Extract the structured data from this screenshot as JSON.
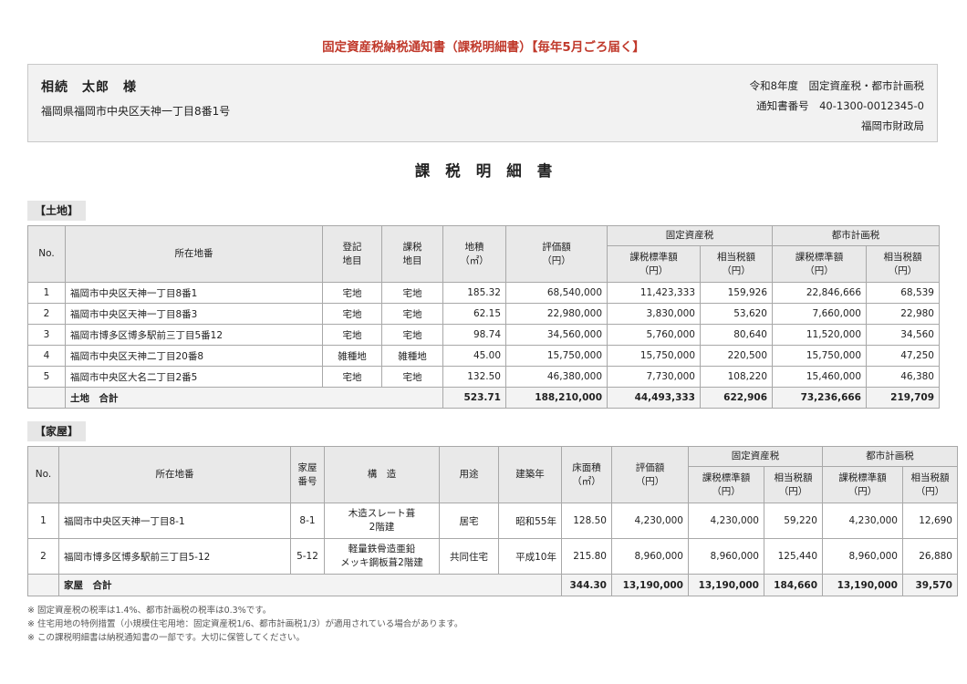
{
  "top_title": "固定資産税納税通知書（課税明細書）【毎年5月ごろ届く】",
  "header": {
    "name": "相続　太郎　様",
    "address": "福岡県福岡市中央区天神一丁目8番1号",
    "year_line": "令和8年度　固定資産税・都市計画税",
    "notice_line": "通知書番号　40-1300-0012345-0",
    "office": "福岡市財政局"
  },
  "doc_title": "課税明細書",
  "land": {
    "label": "【土地】",
    "headers": {
      "no": "No.",
      "location": "所在地番",
      "reg": [
        "登記",
        "地目"
      ],
      "tax_cat": [
        "課税",
        "地目"
      ],
      "area": [
        "地積",
        "（㎡）"
      ],
      "value": [
        "評価額",
        "（円）"
      ],
      "fixed_group": "固定資産税",
      "city_group": "都市計画税",
      "std": [
        "課税標準額",
        "（円）"
      ],
      "tax": [
        "相当税額",
        "（円）"
      ]
    },
    "rows": [
      [
        "1",
        "福岡市中央区天神一丁目8番1",
        "宅地",
        "宅地",
        "185.32",
        "68,540,000",
        "11,423,333",
        "159,926",
        "22,846,666",
        "68,539"
      ],
      [
        "2",
        "福岡市中央区天神一丁目8番3",
        "宅地",
        "宅地",
        "62.15",
        "22,980,000",
        "3,830,000",
        "53,620",
        "7,660,000",
        "22,980"
      ],
      [
        "3",
        "福岡市博多区博多駅前三丁目5番12",
        "宅地",
        "宅地",
        "98.74",
        "34,560,000",
        "5,760,000",
        "80,640",
        "11,520,000",
        "34,560"
      ],
      [
        "4",
        "福岡市中央区天神二丁目20番8",
        "雑種地",
        "雑種地",
        "45.00",
        "15,750,000",
        "15,750,000",
        "220,500",
        "15,750,000",
        "47,250"
      ],
      [
        "5",
        "福岡市中央区大名二丁目2番5",
        "宅地",
        "宅地",
        "132.50",
        "46,380,000",
        "7,730,000",
        "108,220",
        "15,460,000",
        "46,380"
      ]
    ],
    "total": {
      "label": "土地　合計",
      "area": "523.71",
      "value": "188,210,000",
      "fixed_std": "44,493,333",
      "fixed_tax": "622,906",
      "city_std": "73,236,666",
      "city_tax": "219,709"
    }
  },
  "house": {
    "label": "【家屋】",
    "headers": {
      "no": "No.",
      "location": "所在地番",
      "house_no": [
        "家屋",
        "番号"
      ],
      "structure": "構　造",
      "use": "用途",
      "built": "建築年",
      "floor": [
        "床面積",
        "（㎡）"
      ],
      "value": [
        "評価額",
        "（円）"
      ],
      "fixed_group": "固定資産税",
      "city_group": "都市計画税",
      "std": [
        "課税標準額",
        "（円）"
      ],
      "tax": [
        "相当税額",
        "（円）"
      ]
    },
    "rows": [
      {
        "cells": [
          "1",
          "福岡市中央区天神一丁目8-1",
          "8-1",
          "居宅",
          "昭和55年",
          "128.50",
          "4,230,000",
          "4,230,000",
          "59,220",
          "4,230,000",
          "12,690"
        ],
        "structure": [
          "木造スレート葺",
          "2階建"
        ]
      },
      {
        "cells": [
          "2",
          "福岡市博多区博多駅前三丁目5-12",
          "5-12",
          "共同住宅",
          "平成10年",
          "215.80",
          "8,960,000",
          "8,960,000",
          "125,440",
          "8,960,000",
          "26,880"
        ],
        "structure": [
          "軽量鉄骨造亜鉛",
          "メッキ鋼板葺2階建"
        ]
      }
    ],
    "total": {
      "label": "家屋　合計",
      "floor": "344.30",
      "value": "13,190,000",
      "fixed_std": "13,190,000",
      "fixed_tax": "184,660",
      "city_std": "13,190,000",
      "city_tax": "39,570"
    }
  },
  "notes": [
    "※ 固定資産税の税率は1.4%、都市計画税の税率は0.3%です。",
    "※ 住宅用地の特例措置（小規模住宅用地：固定資産税1/6、都市計画税1/3）が適用されている場合があります。",
    "※ この課税明細書は納税通知書の一部です。大切に保管してください。"
  ]
}
